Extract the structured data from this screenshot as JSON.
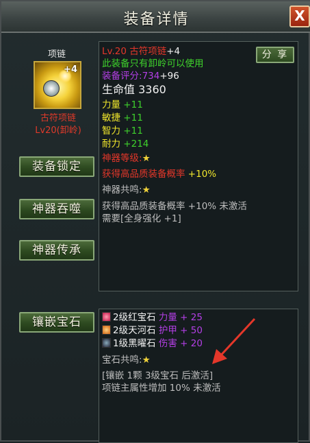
{
  "window": {
    "title": "装备详情",
    "close_label": "X"
  },
  "item": {
    "type": "项链",
    "enhance_level": "+4",
    "name": "古符项链",
    "level_desc": "Lv20(卸岭)"
  },
  "buttons": {
    "lock": "装备锁定",
    "devour": "神器吞噬",
    "inherit": "神器传承",
    "inlay": "镶嵌宝石",
    "share": "分 享"
  },
  "info": {
    "title_line_prefix": "Lv.20 古符项链",
    "title_line_suffix": "+4",
    "restriction": "此装备只有卸岭可以使用",
    "score_label": "装备评分:",
    "score_value": "734",
    "score_bonus": "+96",
    "hp_label": "生命值",
    "hp_value": "3360",
    "stats": [
      {
        "name": "力量",
        "value": "+11"
      },
      {
        "name": "敏捷",
        "value": "+11"
      },
      {
        "name": "智力",
        "value": "+11"
      },
      {
        "name": "耐力",
        "value": "+214"
      }
    ],
    "artifact_level_label": "神器等级:",
    "artifact_bonus_text": "获得高品质装备概率",
    "artifact_bonus_value": "+10%",
    "resonance_label": "神器共鸣:",
    "resonance_effect": "获得高品质装备概率 +10% 未激活",
    "resonance_requirement": "需要[全身强化 +1]"
  },
  "gems": {
    "items": [
      {
        "name": "2级红宝石",
        "stat": "力量 + 25",
        "color": "#c2184a"
      },
      {
        "name": "2级天河石",
        "stat": "护甲 + 50",
        "color": "#d06010"
      },
      {
        "name": "1级黑曜石",
        "stat": "伤害 + 20",
        "color": "#223344"
      }
    ],
    "resonance_label": "宝石共鸣:",
    "resonance_requirement": "[镶嵌 1颗 3级宝石 后激活]",
    "resonance_effect": "项链主属性增加 10% 未激活"
  },
  "colors": {
    "red": "#e4372a",
    "green": "#3fd12c",
    "purple": "#b43fe6",
    "yellow": "#f0e62c"
  }
}
